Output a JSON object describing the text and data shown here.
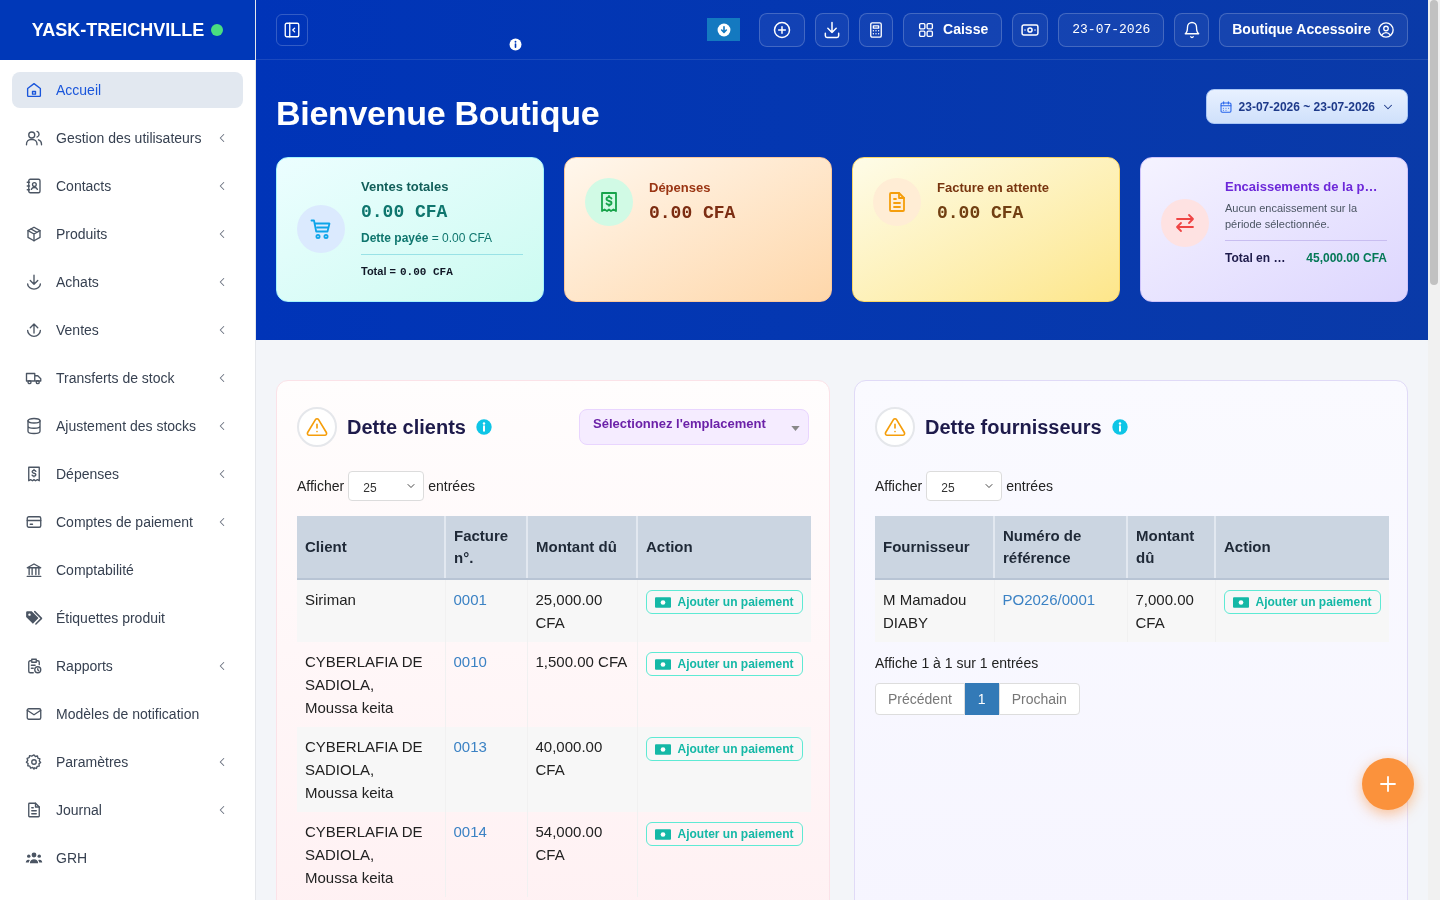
{
  "sidebar": {
    "brand": "YASK-TREICHVILLE",
    "online": true,
    "items": [
      {
        "label": "Accueil",
        "selected": true,
        "expandable": false
      },
      {
        "label": "Gestion des utilisateurs",
        "selected": false,
        "expandable": true
      },
      {
        "label": "Contacts",
        "selected": false,
        "expandable": true
      },
      {
        "label": "Produits",
        "selected": false,
        "expandable": true
      },
      {
        "label": "Achats",
        "selected": false,
        "expandable": true
      },
      {
        "label": "Ventes",
        "selected": false,
        "expandable": true
      },
      {
        "label": "Transferts de stock",
        "selected": false,
        "expandable": true
      },
      {
        "label": "Ajustement des stocks",
        "selected": false,
        "expandable": true
      },
      {
        "label": "Dépenses",
        "selected": false,
        "expandable": true
      },
      {
        "label": "Comptes de paiement",
        "selected": false,
        "expandable": true
      },
      {
        "label": "Comptabilité",
        "selected": false,
        "expandable": false
      },
      {
        "label": "Étiquettes produit",
        "selected": false,
        "expandable": false
      },
      {
        "label": "Rapports",
        "selected": false,
        "expandable": true
      },
      {
        "label": "Modèles de notification",
        "selected": false,
        "expandable": false
      },
      {
        "label": "Paramètres",
        "selected": false,
        "expandable": true
      },
      {
        "label": "Journal",
        "selected": false,
        "expandable": true
      },
      {
        "label": "GRH",
        "selected": false,
        "expandable": false
      }
    ]
  },
  "top_bar": {
    "cash_register": "Caisse",
    "date": "23-07-2026",
    "account": "Boutique Accessoire"
  },
  "header": {
    "title": "Bienvenue Boutique",
    "date_range": "23-07-2026 ~ 23-07-2026"
  },
  "cards": [
    {
      "kind": "sales",
      "title": "Ventes totales",
      "value": "0.00 CFA",
      "detail": "**Dette payée** = 0.00 CFA",
      "total_label": "Total =",
      "total_value": "0.00 CFA"
    },
    {
      "kind": "expenses",
      "title": "Dépenses",
      "value": "0.00 CFA"
    },
    {
      "kind": "pending",
      "title": "Facture en attente",
      "value": "0.00 CFA"
    },
    {
      "kind": "collections",
      "title": "Encaissements de la p…",
      "note": "Aucun encaissement sur la période sélectionnée.",
      "total_label": "Total en …",
      "total_value": "45,000.00 CFA"
    }
  ],
  "customer_debt": {
    "title": "Dette clients",
    "location_select": {
      "placeholder": "Sélectionnez l'emplacement"
    },
    "page_length": {
      "label": "Afficher",
      "value": "25",
      "suffix": "entrées"
    },
    "table": {
      "columns": [
        {
          "label": "Client",
          "kind": "text"
        },
        {
          "label": "Facture n°.",
          "kind": "link"
        },
        {
          "label": "Montant dû",
          "kind": "text"
        },
        {
          "label": "Action",
          "kind": "action"
        }
      ],
      "rows": [
        [
          "Siriman",
          "0001",
          "25,000.00 CFA",
          "Ajouter un paiement"
        ],
        [
          "CYBERLAFIA DE SADIOLA, Moussa keita",
          "0010",
          "1,500.00 CFA",
          "Ajouter un paiement"
        ],
        [
          "CYBERLAFIA DE SADIOLA, Moussa keita",
          "0013",
          "40,000.00 CFA",
          "Ajouter un paiement"
        ],
        [
          "CYBERLAFIA DE SADIOLA, Moussa keita",
          "0014",
          "54,000.00 CFA",
          "Ajouter un paiement"
        ]
      ]
    }
  },
  "supplier_debt": {
    "title": "Dette fournisseurs",
    "page_length": {
      "label": "Afficher",
      "value": "25",
      "suffix": "entrées"
    },
    "table": {
      "columns": [
        {
          "label": "Fournisseur",
          "kind": "text"
        },
        {
          "label": "Numéro de référence",
          "kind": "link"
        },
        {
          "label": "Montant dû",
          "kind": "text"
        },
        {
          "label": "Action",
          "kind": "action"
        }
      ],
      "rows": [
        [
          "M Mamadou DIABY",
          "PO2026/0001",
          "7,000.00 CFA",
          "Ajouter un paiement"
        ]
      ]
    },
    "info": "Affiche 1 à 1 sur 1 entrées",
    "pagination": {
      "previous": "Précédent",
      "pages": [
        {
          "label": "1",
          "selected": true
        }
      ],
      "next": "Prochain"
    }
  }
}
